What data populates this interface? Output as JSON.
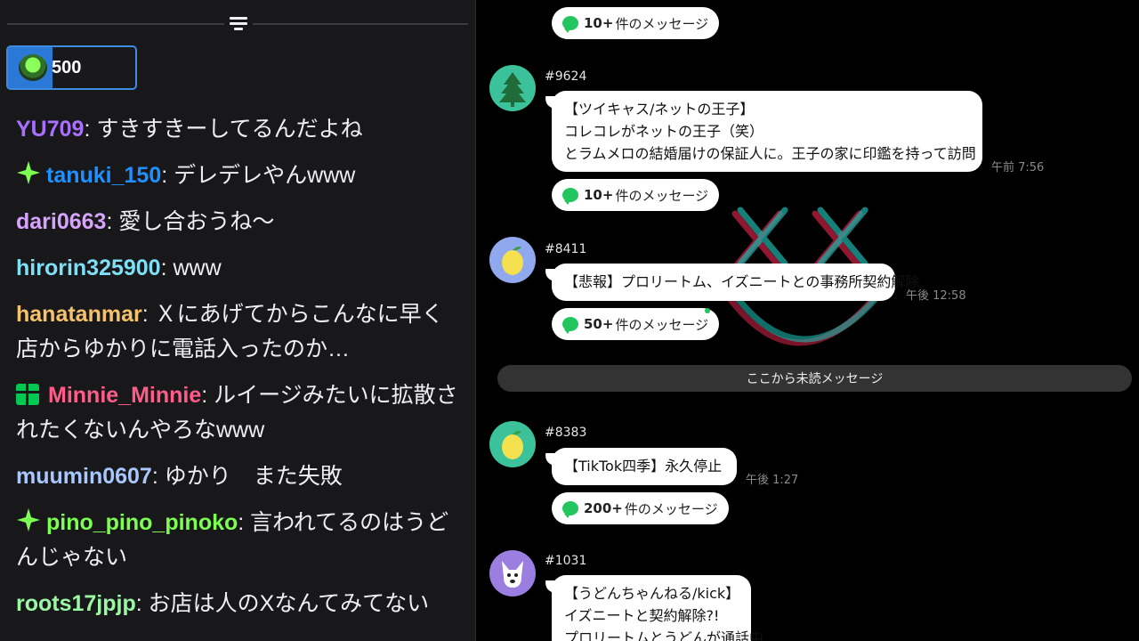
{
  "chat": {
    "points": {
      "value": "500",
      "fill_fraction": 0.35
    },
    "messages": [
      {
        "user": "YU709",
        "color": "#a970ff",
        "badge": "",
        "text": ": すきすきーしてるんだよね"
      },
      {
        "user": "tanuki_150",
        "color": "#1e90ff",
        "badge": "diamond",
        "text": ": デレデレやんwww"
      },
      {
        "user": "dari0663",
        "color": "#d8a3ff",
        "badge": "",
        "text": ": 愛し合おうね～"
      },
      {
        "user": "hirorin325900",
        "color": "#7fe0f5",
        "badge": "",
        "text": ": www"
      },
      {
        "user": "hanatanmar",
        "color": "#f5c26b",
        "badge": "",
        "text": ": Ｘにあげてからこんなに早く店からゆかりに電話入ったのか…"
      },
      {
        "user": "Minnie_Minnie",
        "color": "#ff5c8a",
        "badge": "gift",
        "text": ": ルイージみたいに拡散されたくないんやろなwww"
      },
      {
        "user": "muumin0607",
        "color": "#a9c7ff",
        "badge": "",
        "text": ": ゆかり　また失敗"
      },
      {
        "user": "pino_pino_pinoko",
        "color": "#7dff52",
        "badge": "diamond",
        "text": ": 言われてるのはうどんじゃない"
      },
      {
        "user": "roots17jpjp",
        "color": "#9cf7a5",
        "badge": "",
        "text": ": お店は人のXなんてみてない"
      }
    ]
  },
  "bbs": {
    "top_pill": {
      "count": "10+",
      "suffix": "件のメッセージ"
    },
    "posts": [
      {
        "id": "#9624",
        "avatar_icon": "tree-icon",
        "avatar_bg": "#3cc29a",
        "lines": [
          "【ツイキャス/ネットの王子】",
          "コレコレがネットの王子（笑）",
          "とラムメロの結婚届けの保証人に。王子の家に印鑑を持って訪問"
        ],
        "time": "午前 7:56",
        "reply_count": "10+",
        "reply_suffix": "件のメッセージ"
      },
      {
        "id": "#8411",
        "avatar_icon": "lemon-icon",
        "avatar_bg": "#8fa8ee",
        "lines": [
          "【悲報】プロリートム、イズニートとの事務所契約解除"
        ],
        "time": "午後 12:58",
        "reply_count": "50+",
        "reply_suffix": "件のメッセージ"
      },
      {
        "id": "#8383",
        "avatar_icon": "lemon-icon",
        "avatar_bg": "#3cc29a",
        "lines": [
          "【TikTok四季】永久停止"
        ],
        "time": "午後 1:27",
        "reply_count": "200+",
        "reply_suffix": "件のメッセージ"
      },
      {
        "id": "#1031",
        "avatar_icon": "dog-icon",
        "avatar_bg": "#9b7fe0",
        "lines": [
          "【うどんちゃんねる/kick】",
          "イズニートと契約解除?!",
          "プロリートムとうどんが通話中"
        ],
        "time": "",
        "reply_count": "",
        "reply_suffix": ""
      }
    ],
    "unread_label": "ここから未読メッセージ"
  }
}
